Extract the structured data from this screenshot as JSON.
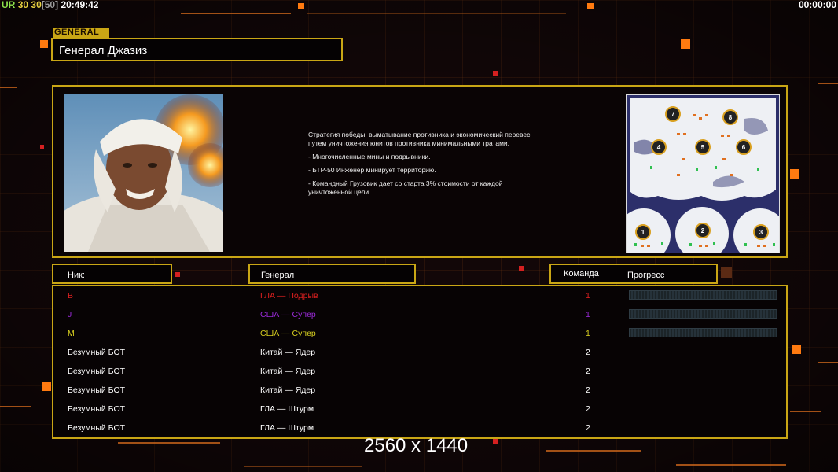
{
  "hud": {
    "prefix": "UR",
    "val1": "30",
    "val2": "30",
    "bracket": "[50]",
    "clock": "20:49:42",
    "timer": "00:00:00"
  },
  "general_tag": "GENERAL",
  "general_name": "Генерал Джазиз",
  "description": [
    "Стратегия победы: выматывание противника и экономический перевес путем уничтожения юнитов противника минимальными тратами.",
    "- Многочисленные мины и подрывники.",
    "- БТР-50 Инженер минирует территорию.",
    "- Командный Грузовик дает со старта 3% стоимости от каждой уничтоженной цели."
  ],
  "map_slots": [
    "7",
    "8",
    "4",
    "5",
    "6",
    "1",
    "2",
    "3"
  ],
  "headers": {
    "nick": "Ник:",
    "general": "Генерал",
    "team": "Команда",
    "progress": "Прогресс"
  },
  "players": [
    {
      "nick": "B",
      "general": "ГЛА — Подрыв",
      "team": "1",
      "color": "#e02020",
      "progress": 0
    },
    {
      "nick": "J",
      "general": "США — Супер",
      "team": "1",
      "color": "#9a2ad8",
      "progress": 0
    },
    {
      "nick": "M",
      "general": "США — Супер",
      "team": "1",
      "color": "#d8d020",
      "progress": 0
    },
    {
      "nick": "Безумный БОТ",
      "general": "Китай — Ядер",
      "team": "2",
      "color": "#ffffff"
    },
    {
      "nick": "Безумный БОТ",
      "general": "Китай — Ядер",
      "team": "2",
      "color": "#ffffff"
    },
    {
      "nick": "Безумный БОТ",
      "general": "Китай — Ядер",
      "team": "2",
      "color": "#ffffff"
    },
    {
      "nick": "Безумный БОТ",
      "general": "ГЛА — Штурм",
      "team": "2",
      "color": "#ffffff"
    },
    {
      "nick": "Безумный БОТ",
      "general": "ГЛА — Штурм",
      "team": "2",
      "color": "#ffffff"
    }
  ],
  "watermark": "2560 x 1440",
  "colors": {
    "gold": "#c9a615",
    "accent": "#ff7a10"
  }
}
